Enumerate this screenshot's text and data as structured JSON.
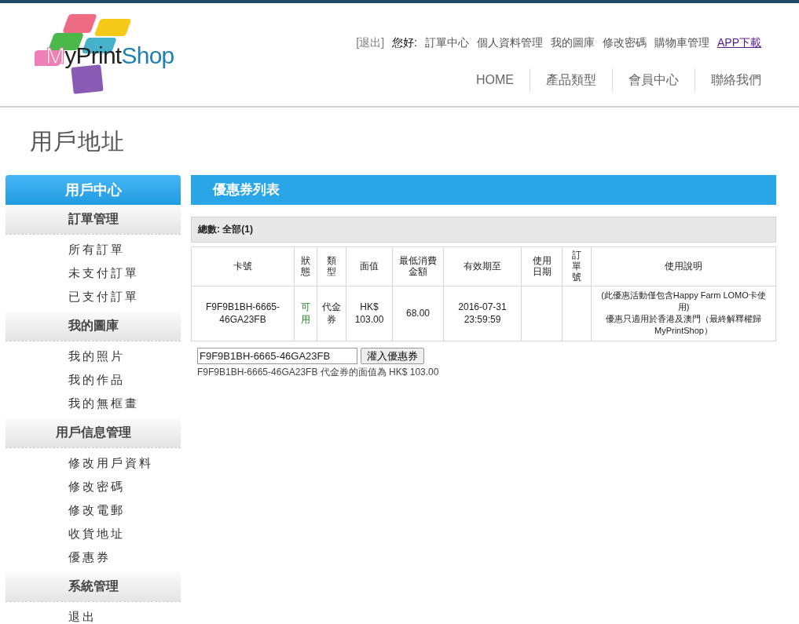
{
  "logo": {
    "parts": [
      "M",
      "yPrint",
      "Shop"
    ]
  },
  "top_links": {
    "logout": "[退出]",
    "greeting": "您好:",
    "links": [
      "訂單中心",
      "個人資料管理",
      "我的圖庫",
      "修改密碼",
      "購物車管理",
      "APP下載"
    ]
  },
  "main_nav": [
    "HOME",
    "產品類型",
    "會員中心",
    "聯絡我們"
  ],
  "page_title": "用戶地址",
  "sidebar": {
    "title": "用戶中心",
    "groups": [
      {
        "label": "訂單管理",
        "items": [
          "所有訂單",
          "未支付訂單",
          "已支付訂單"
        ]
      },
      {
        "label": "我的圖庫",
        "items": [
          "我的照片",
          "我的作品",
          "我的無框畫"
        ]
      },
      {
        "label": "用戶信息管理",
        "items": [
          "修改用戶資料",
          "修改密碼",
          "修改電郵",
          "收貨地址",
          "優惠券"
        ]
      },
      {
        "label": "系統管理",
        "items": [
          "退出"
        ]
      }
    ]
  },
  "panel": {
    "title": "優惠券列表",
    "total": "總數: 全部(1)",
    "table": {
      "columns": [
        "卡號",
        "狀態",
        "類型",
        "面值",
        "最低消費金額",
        "有效期至",
        "使用日期",
        "訂單號",
        "使用說明"
      ],
      "rows": [
        {
          "card": "F9F9B1BH-6665-46GA23FB",
          "status": "可用",
          "type": "代金券",
          "value": "HK$ 103.00",
          "min_spend": "68.00",
          "expiry": "2016-07-31 23:59:59",
          "used_date": "",
          "order_no": "",
          "notes": [
            "(此優惠活動僅包含Happy Farm LOMO卡使用)",
            "優惠只適用於香港及澳門（最終解釋權歸MyPrintShop）"
          ]
        }
      ]
    },
    "coupon_input": {
      "value": "F9F9B1BH-6665-46GA23FB",
      "button": "灌入優惠券"
    },
    "result": "F9F9B1BH-6665-46GA23FB 代金券的面值為 HK$ 103.00"
  }
}
